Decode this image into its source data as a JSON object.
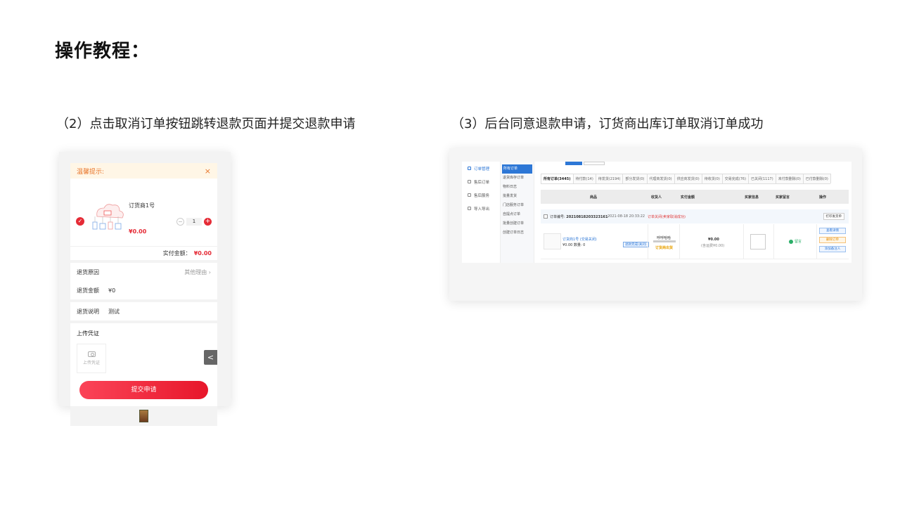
{
  "title": "操作教程：",
  "steps": {
    "step2": "（2）点击取消订单按钮跳转退款页面并提交退款申请",
    "step3": "（3）后台同意退款申请，订货商出库订单取消订单成功"
  },
  "mobile": {
    "tip": "温馨提示:",
    "close": "×",
    "product_name": "订货商1号",
    "product_price": "¥0.00",
    "quantity": "1",
    "minus": "−",
    "plus": "+",
    "check": "✓",
    "pay_label": "实付金额：",
    "pay_amount": "¥0.00",
    "reason_label": "退货原因",
    "reason_value": "其他理由 ›",
    "amount_label": "退货金额",
    "amount_value": "¥0",
    "desc_label": "退货说明",
    "desc_value": "测试",
    "upload_title": "上传凭证",
    "upload_box": "上传凭证",
    "back": "<",
    "submit": "提交申请"
  },
  "admin": {
    "side_menu": [
      "订单管理",
      "售后订单",
      "售后服务",
      "导入导出"
    ],
    "sub_menu": [
      "所有订单",
      "退货库存订单",
      "物料日志",
      "批量发货",
      "门店服务订单",
      "自提点订单",
      "批量创建订单",
      "创建订单日志"
    ],
    "tabs": [
      "所有订单(3445)",
      "待付款(14)",
      "待发货(2194)",
      "部分发货(0)",
      "代理商发货(0)",
      "供应商发货(0)",
      "待收货(0)",
      "交易完成(76)",
      "已关闭(1117)",
      "未付款删除(0)",
      "已付款删除(0)"
    ],
    "columns": [
      "商品",
      "收货人",
      "实付金额",
      "买家信息",
      "买家留言",
      "操作"
    ],
    "order_no_label": "订单编号:",
    "order_no": "20210818203323161",
    "order_time": "2021-08-18 20:33:22",
    "order_status": "订单关闭(卖家取消成功)",
    "print_btn": "打印发货单",
    "product_name": "订货商1号 (交易关闭)",
    "product_price": "¥0.00 数量: 0",
    "badge": "退款完成(关闭)",
    "receiver": "呼呼哈哈",
    "receiver_status": "订货商出货",
    "amount": "¥0.00",
    "amount_note": "(含运费¥0.00)",
    "message": "留言",
    "ops": [
      "查看详情",
      "删除订单",
      "添加备注人"
    ]
  }
}
